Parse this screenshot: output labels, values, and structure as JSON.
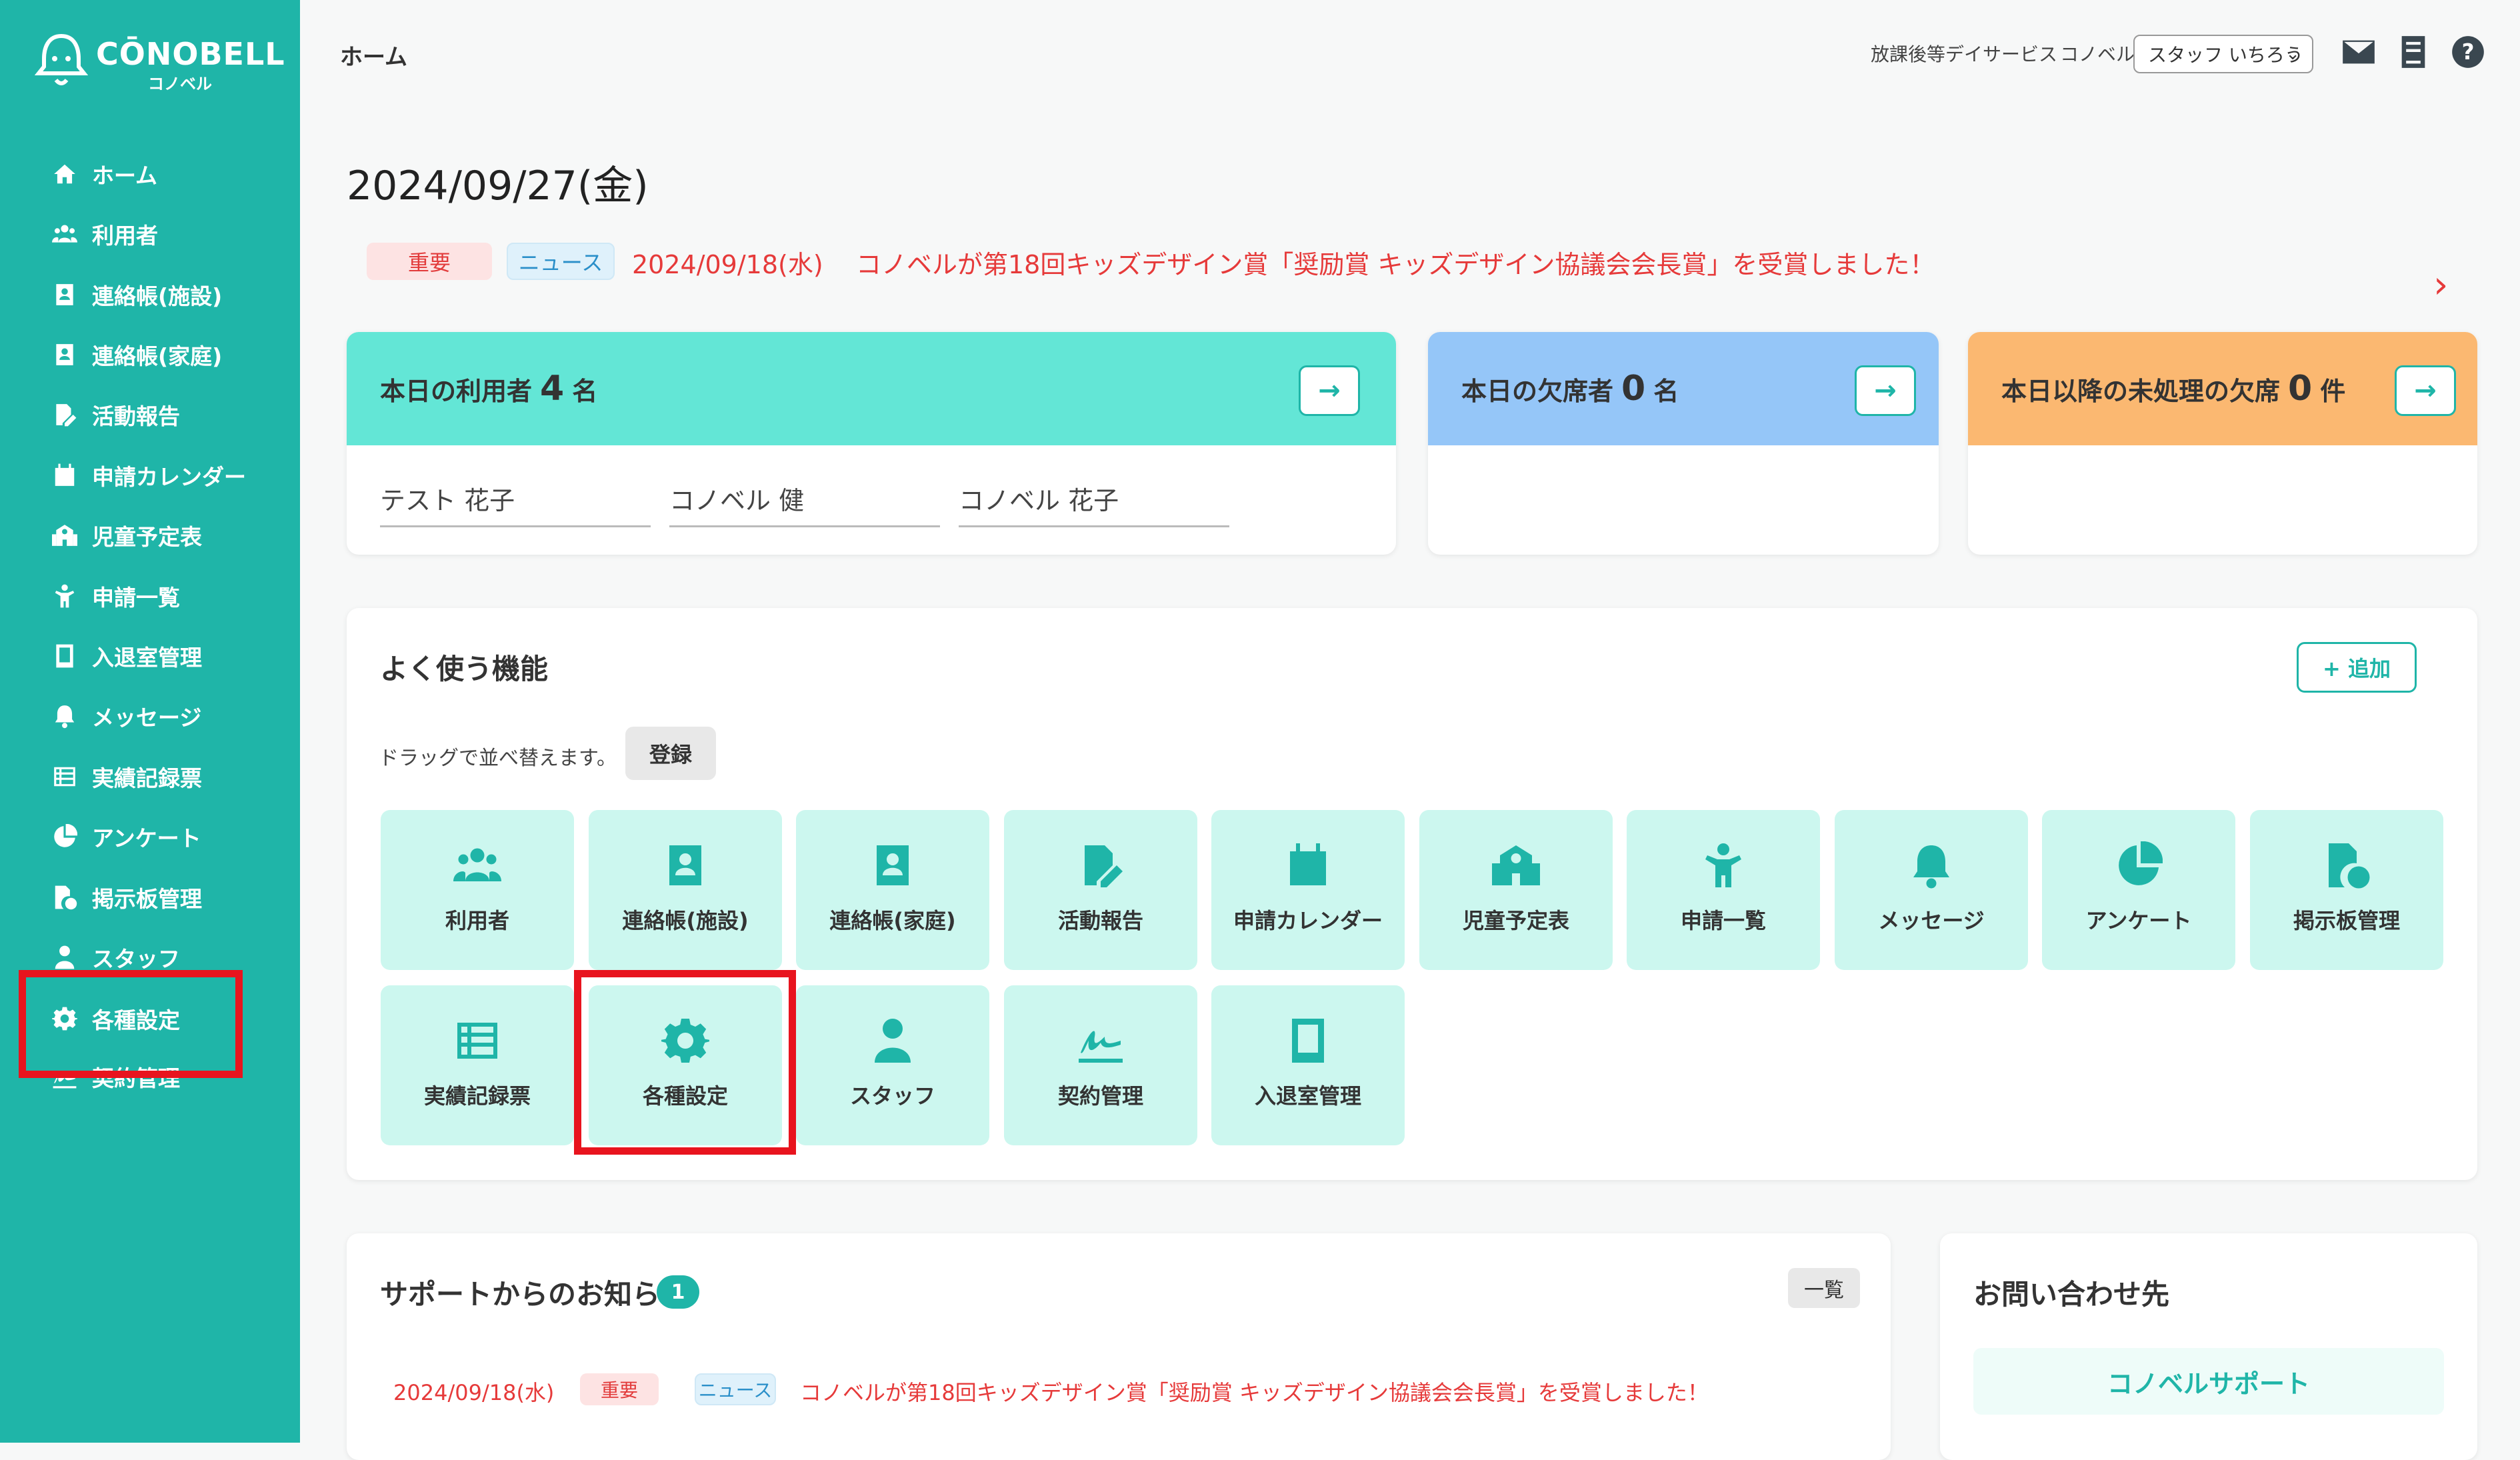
{
  "app": {
    "brand": "CŌNOBELL",
    "brand_sub": "コノベル"
  },
  "sidebar": {
    "items": [
      {
        "label": "ホーム",
        "icon": "home-icon"
      },
      {
        "label": "利用者",
        "icon": "users-icon"
      },
      {
        "label": "連絡帳(施設)",
        "icon": "contact-book-icon"
      },
      {
        "label": "連絡帳(家庭)",
        "icon": "contact-book-icon"
      },
      {
        "label": "活動報告",
        "icon": "report-edit-icon"
      },
      {
        "label": "申請カレンダー",
        "icon": "calendar-icon"
      },
      {
        "label": "児童予定表",
        "icon": "school-icon"
      },
      {
        "label": "申請一覧",
        "icon": "child-icon"
      },
      {
        "label": "入退室管理",
        "icon": "tablet-icon"
      },
      {
        "label": "メッセージ",
        "icon": "bell-icon"
      },
      {
        "label": "実績記録票",
        "icon": "list-table-icon"
      },
      {
        "label": "アンケート",
        "icon": "pie-chart-icon"
      },
      {
        "label": "掲示板管理",
        "icon": "file-check-icon"
      },
      {
        "label": "スタッフ",
        "icon": "staff-icon"
      },
      {
        "label": "各種設定",
        "icon": "gear-icon"
      },
      {
        "label": "契約管理",
        "icon": "signature-icon"
      }
    ]
  },
  "topbar": {
    "page_title": "ホーム",
    "service": "放課後等デイサービス",
    "org": "コノベル",
    "staff_select": "スタッフ いちろう"
  },
  "main": {
    "date": "2024/09/27(金)",
    "news": {
      "badge_important": "重要",
      "badge_news": "ニュース",
      "date": "2024/09/18(水)",
      "text": "コノベルが第18回キッズデザイン賞「奨励賞 キッズデザイン協議会会長賞」を受賞しました！"
    },
    "stats": {
      "today_users": {
        "prefix": "本日の利用者",
        "count": "4",
        "unit": "名"
      },
      "absent": {
        "prefix": "本日の欠席者",
        "count": "0",
        "unit": "名"
      },
      "unprocessed": {
        "prefix": "本日以降の未処理の欠席",
        "count": "0",
        "unit": "件"
      },
      "user_names": [
        "テスト 花子",
        "コノベル 健",
        "コノベル 花子"
      ]
    },
    "favorites": {
      "title": "よく使う機能",
      "add_label": "+ 追加",
      "drag_note": "ドラッグで並べ替えます。",
      "register_label": "登録",
      "tiles": [
        {
          "label": "利用者",
          "icon": "users-icon"
        },
        {
          "label": "連絡帳(施設)",
          "icon": "contact-book-icon"
        },
        {
          "label": "連絡帳(家庭)",
          "icon": "contact-book-icon"
        },
        {
          "label": "活動報告",
          "icon": "report-edit-icon"
        },
        {
          "label": "申請カレンダー",
          "icon": "calendar-icon"
        },
        {
          "label": "児童予定表",
          "icon": "school-icon"
        },
        {
          "label": "申請一覧",
          "icon": "child-icon"
        },
        {
          "label": "メッセージ",
          "icon": "bell-icon"
        },
        {
          "label": "アンケート",
          "icon": "pie-chart-icon"
        },
        {
          "label": "掲示板管理",
          "icon": "file-check-icon"
        },
        {
          "label": "実績記録票",
          "icon": "list-table-icon"
        },
        {
          "label": "各種設定",
          "icon": "gear-icon"
        },
        {
          "label": "スタッフ",
          "icon": "staff-icon"
        },
        {
          "label": "契約管理",
          "icon": "signature-icon"
        },
        {
          "label": "入退室管理",
          "icon": "tablet-icon"
        }
      ]
    },
    "support": {
      "title": "サポートからのお知らせ",
      "count": "1",
      "list_label": "一覧",
      "item_date": "2024/09/18(水)",
      "item_badge_important": "重要",
      "item_badge_news": "ニュース",
      "item_text": "コノベルが第18回キッズデザイン賞「奨励賞 キッズデザイン協議会会長賞」を受賞しました！"
    },
    "contact": {
      "title": "お問い合わせ先",
      "support_button": "コノベルサポート"
    }
  },
  "colors": {
    "brand": "#1fb5a8",
    "stat_users": "#63e6d6",
    "stat_absent": "#95c6f8",
    "stat_unprocessed": "#fbb871",
    "tile_bg": "#ccf7ef",
    "highlight": "#e8141e",
    "news_red": "#e63a3a"
  }
}
